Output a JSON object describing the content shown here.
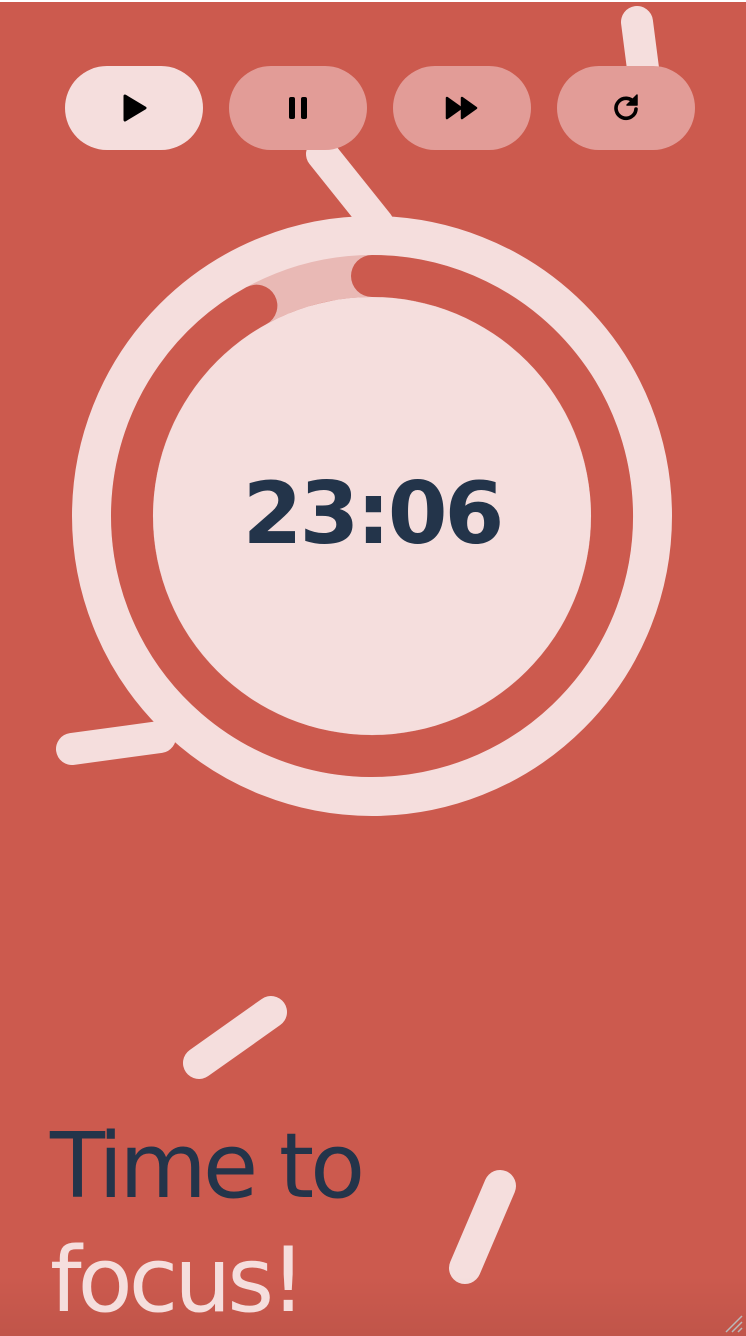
{
  "controls": {
    "play": {
      "label": "Play",
      "icon": "play-icon",
      "active": true
    },
    "pause": {
      "label": "Pause",
      "icon": "pause-icon",
      "active": false
    },
    "skip": {
      "label": "Skip",
      "icon": "fast-forward-icon",
      "active": false
    },
    "reset": {
      "label": "Reset",
      "icon": "reset-icon",
      "active": false
    }
  },
  "timer": {
    "time": "23:06",
    "progress_fraction": 0.92
  },
  "headline": {
    "line1": "Time to",
    "line2": "focus!"
  },
  "colors": {
    "background": "#cc5a4e",
    "light": "#f5dedd",
    "button_idle": "#e29c97",
    "dark_text": "#23344a",
    "progress_remaining": "#e9b9b5"
  }
}
